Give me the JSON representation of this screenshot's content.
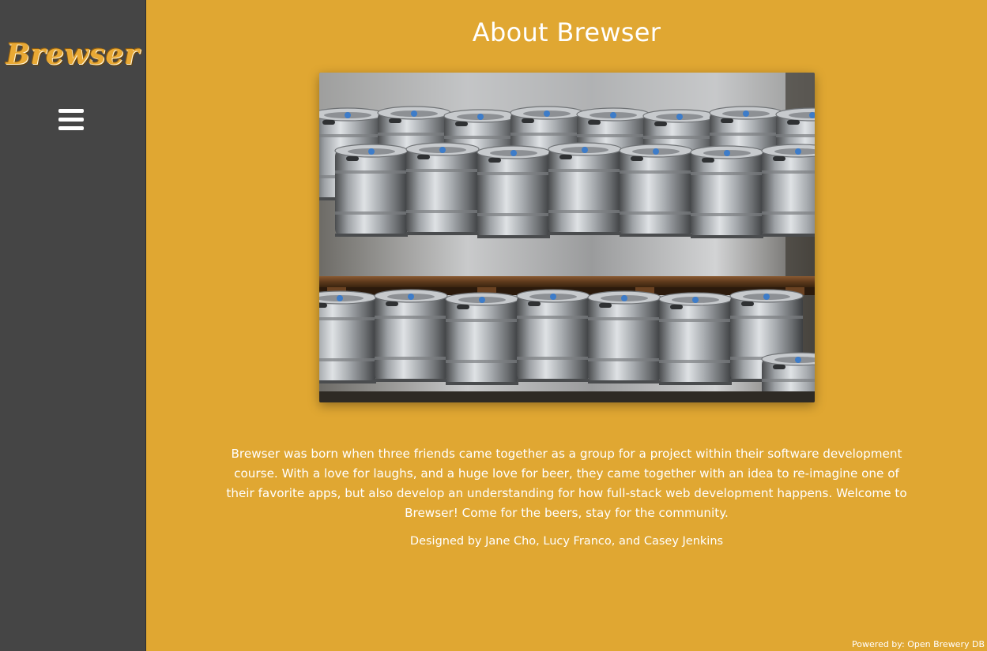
{
  "sidebar": {
    "logo_text": "Brewser",
    "menu_icon": "hamburger-menu-icon"
  },
  "main": {
    "title": "About Brewser",
    "image_subject": "stacked steel beer kegs on wooden pallets",
    "about_text": "Brewser was born when three friends came together as a group for a project within their software development course. With a love for laughs, and a huge love for beer, they came together with an idea to re-imagine one of their favorite apps, but also develop an understanding for how full-stack web development happens. Welcome to Brewser! Come for the beers, stay for the community.",
    "credits": "Designed by Jane Cho, Lucy Franco, and Casey Jenkins"
  },
  "footer": {
    "powered_label": "Powered by:",
    "powered_link": "Open Brewery DB"
  },
  "colors": {
    "background": "#e0a732",
    "sidebar": "#454545",
    "logo": "#e9a935",
    "text": "#ffffff"
  }
}
